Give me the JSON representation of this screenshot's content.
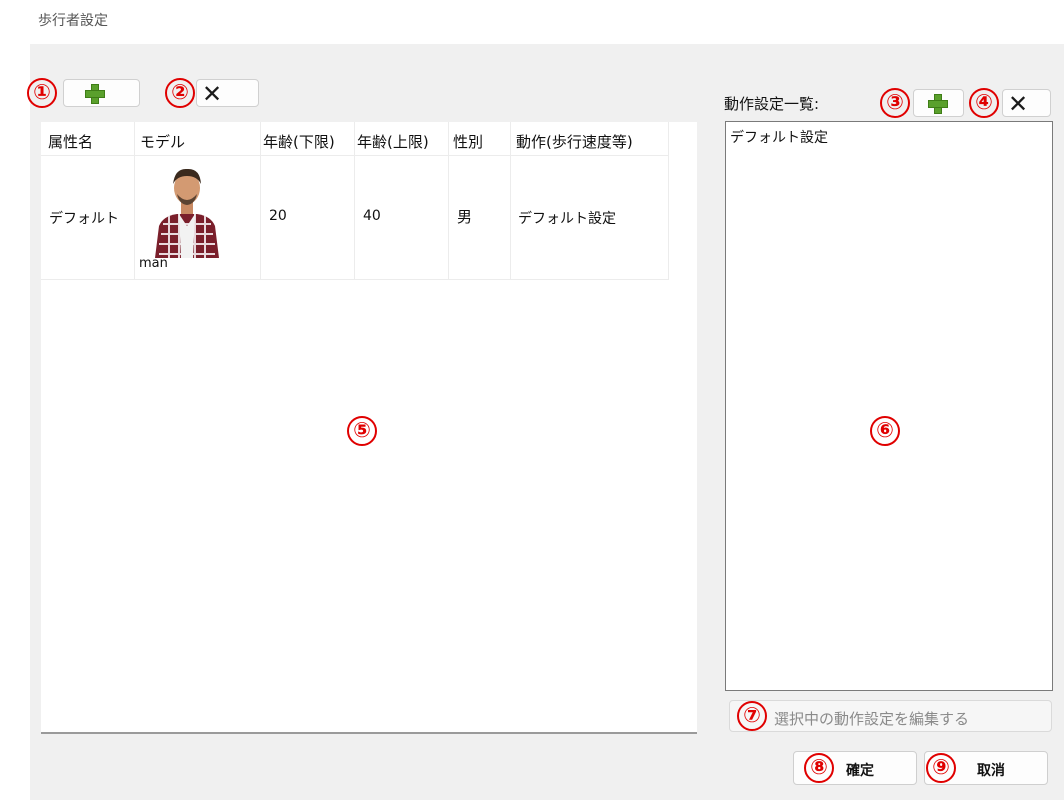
{
  "window": {
    "title": "歩行者設定"
  },
  "badges": [
    "①",
    "②",
    "③",
    "④",
    "⑤",
    "⑥",
    "⑦",
    "⑧",
    "⑨"
  ],
  "attribute_table": {
    "columns": [
      "属性名",
      "モデル",
      "年齢(下限)",
      "年齢(上限)",
      "性別",
      "動作(歩行速度等)"
    ],
    "rows": [
      {
        "name": "デフォルト",
        "model": "man",
        "age_min": "20",
        "age_max": "40",
        "gender": "男",
        "motion": "デフォルト設定"
      }
    ]
  },
  "motion_list": {
    "label": "動作設定一覧:",
    "items": [
      "デフォルト設定"
    ]
  },
  "edit_button": {
    "label": "選択中の動作設定を編集する"
  },
  "footer": {
    "ok_label": "確定",
    "cancel_label": "取消"
  },
  "colors": {
    "badge": "#e00000",
    "plus": "#5aa02c",
    "background": "#f0f0f0"
  },
  "icons": [
    "plus-icon",
    "close-icon"
  ]
}
